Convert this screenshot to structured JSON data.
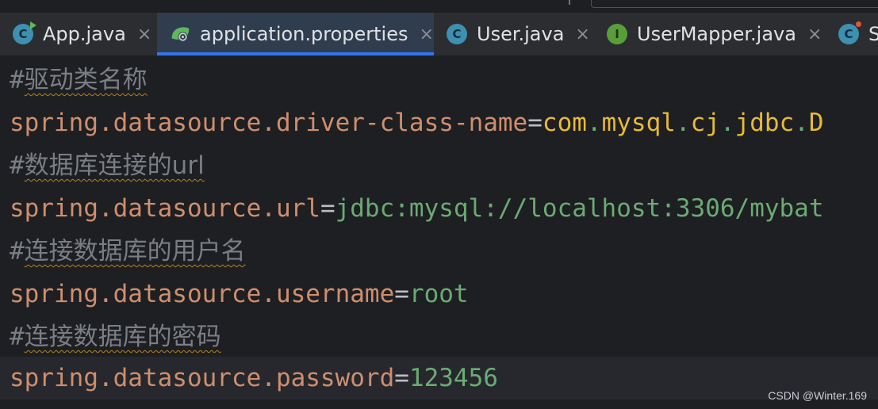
{
  "tabs": [
    {
      "label": "App.java",
      "icon": "java-class-run-icon",
      "active": false
    },
    {
      "label": "application.properties",
      "icon": "properties-file-icon",
      "active": true
    },
    {
      "label": "User.java",
      "icon": "java-class-icon",
      "active": false
    },
    {
      "label": "UserMapper.java",
      "icon": "java-interface-icon",
      "active": false
    },
    {
      "label": "S",
      "icon": "java-class-error-icon",
      "active": false
    }
  ],
  "tab_icon_glyphs": {
    "class": "C",
    "interface": "I"
  },
  "close_glyph": "×",
  "editor": {
    "lines": [
      {
        "type": "comment",
        "hash": "#",
        "text": "驱动类名称"
      },
      {
        "type": "property",
        "key": "spring.datasource.driver-class-name",
        "eq": "=",
        "value_parts": [
          "com",
          ".",
          "mysql",
          ".",
          "cj",
          ".",
          "jdbc",
          ".",
          "D"
        ]
      },
      {
        "type": "comment",
        "hash": "#",
        "text": "数据库连接的url"
      },
      {
        "type": "property",
        "key": "spring.datasource.url",
        "eq": "=",
        "value": "jdbc:mysql://localhost:3306/mybat"
      },
      {
        "type": "comment",
        "hash": "#",
        "text": "连接数据库的用户名"
      },
      {
        "type": "property",
        "key": "spring.datasource.username",
        "eq": "=",
        "value": "root"
      },
      {
        "type": "comment",
        "hash": "#",
        "text": "连接数据库的密码"
      },
      {
        "type": "property",
        "key": "spring.datasource.password",
        "eq": "=",
        "value": "123456"
      }
    ]
  },
  "watermark": "CSDN @Winter.169",
  "colors": {
    "background": "#1e1f22",
    "tabbar": "#2b2d30",
    "active_tab": "#2f3d4f",
    "active_underline": "#3574f0",
    "comment": "#7a7e85",
    "key": "#cf8e6d",
    "string_value": "#6aab73",
    "class_path_value": "#e8ba36",
    "spellcheck_underline": "#b5841e"
  }
}
